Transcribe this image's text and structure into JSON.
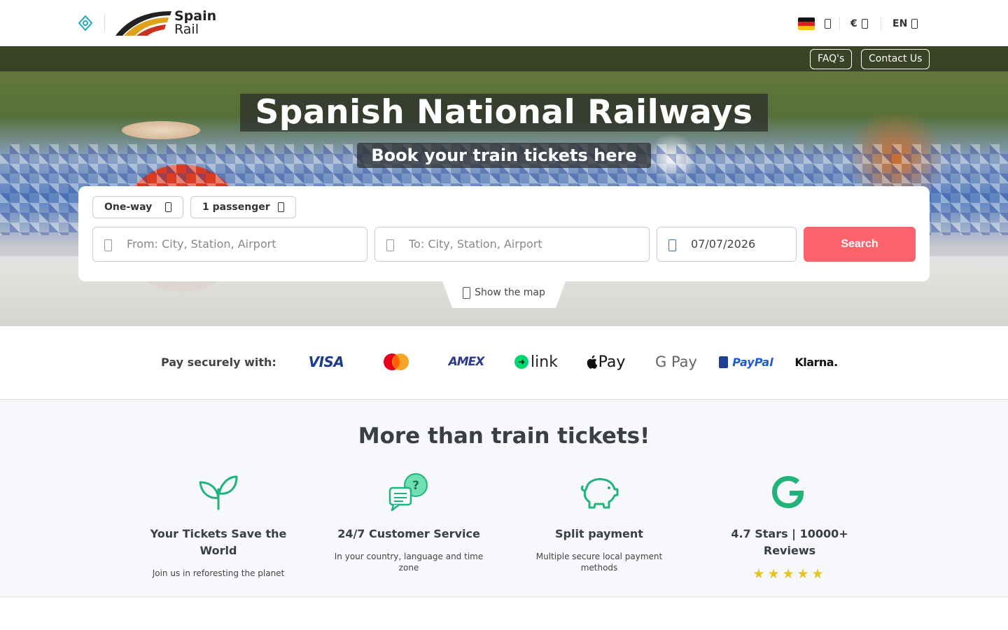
{
  "header": {
    "logo_line1": "Spain",
    "logo_line2": "Rail",
    "country_icon": "germany-flag",
    "currency": "€",
    "language": "EN"
  },
  "hero": {
    "faq_label": "FAQ's",
    "contact_label": "Contact Us",
    "title": "Spanish National Railways",
    "subtitle": "Book your train tickets here"
  },
  "search": {
    "trip_type": "One-way",
    "passengers": "1 passenger",
    "from_placeholder": "From: City, Station, Airport",
    "to_placeholder": "To: City, Station, Airport",
    "date_value": "07/07/2026",
    "search_label": "Search",
    "map_label": "Show the map"
  },
  "payment": {
    "label": "Pay securely with:",
    "methods": [
      "VISA",
      "Mastercard",
      "AMEX",
      "link",
      "Pay",
      "G Pay",
      "PayPal",
      "Klarna."
    ]
  },
  "features": {
    "title": "More than train tickets!",
    "items": [
      {
        "icon": "leaf-icon",
        "name": "Your Tickets Save the World",
        "desc": "Join us in reforesting the planet"
      },
      {
        "icon": "chat-question-icon",
        "name": "24/7 Customer Service",
        "desc": "In your country, language and time zone"
      },
      {
        "icon": "piggy-bank-icon",
        "name": "Split payment",
        "desc": "Multiple secure local payment methods"
      },
      {
        "icon": "google-icon",
        "name": "4.7 Stars | 10000+ Reviews",
        "stars": "★★★★★"
      }
    ]
  },
  "colors": {
    "accent_search": "#fd636b",
    "feature_icon": "#22b37b",
    "star": "#e8c31c"
  }
}
